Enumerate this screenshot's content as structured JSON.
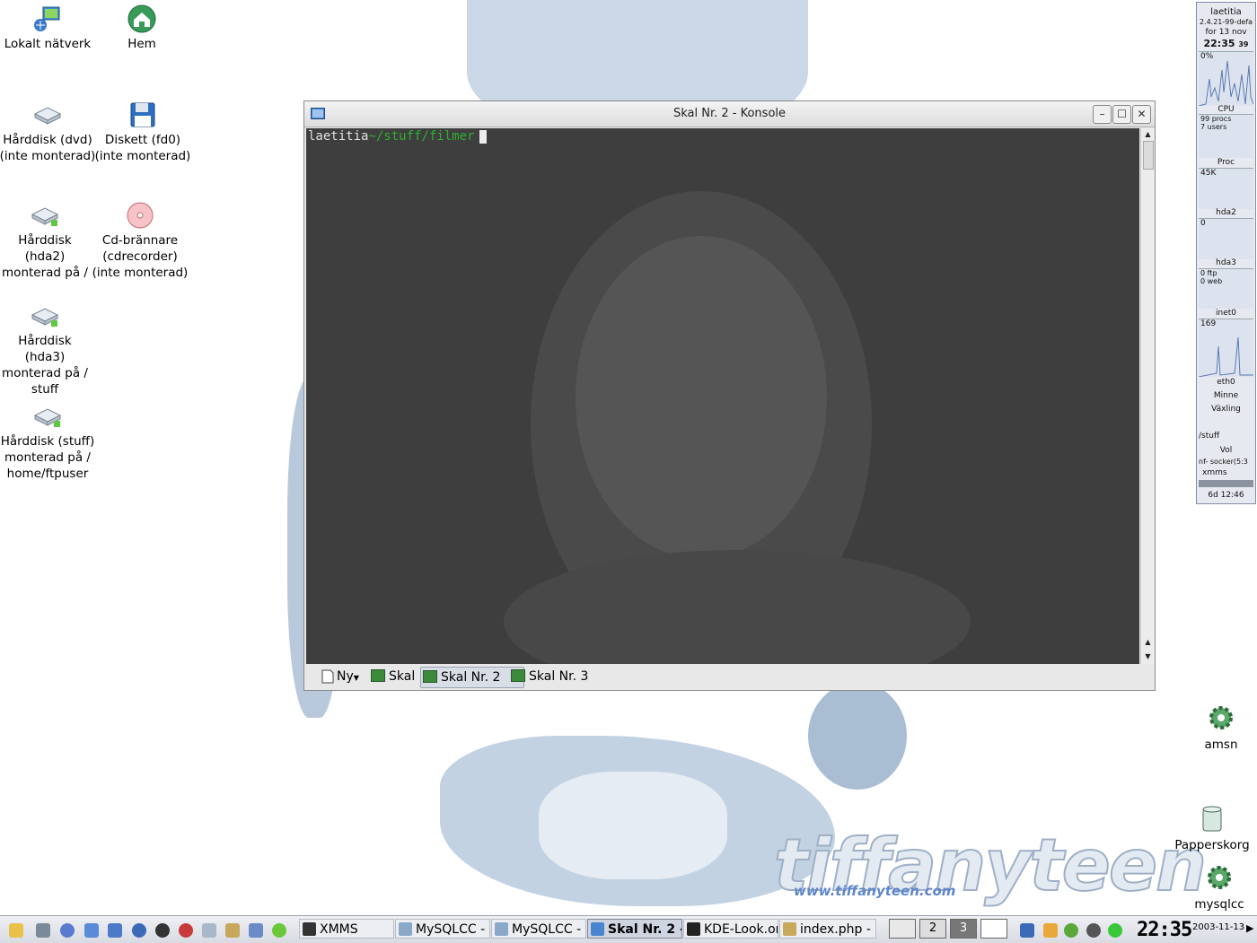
{
  "desktop": {
    "icons_left": [
      {
        "name": "Lokalt nätverk",
        "icon": "network-icon"
      },
      {
        "name": "Hem",
        "icon": "home-icon"
      },
      {
        "name": "Hårddisk (dvd)\n(inte monterad)",
        "icon": "hard-disk-icon"
      },
      {
        "name": "Diskett (fd0)\n(inte monterad)",
        "icon": "floppy-icon"
      },
      {
        "name": "Hårddisk\n(hda2)\nmonterad på /",
        "icon": "hard-disk-icon"
      },
      {
        "name": "Cd-brännare\n(cdrecorder)\n(inte monterad)",
        "icon": "cd-icon"
      },
      {
        "name": "Hårddisk\n(hda3)\nmonterad på /\nstuff",
        "icon": "hard-disk-icon"
      },
      {
        "name": "Hårddisk (stuff)\nmonterad på /\nhome/ftpuser",
        "icon": "hard-disk-icon"
      }
    ],
    "icons_right": [
      {
        "name": "amsn",
        "icon": "gear-icon"
      },
      {
        "name": "Papperskorg",
        "icon": "trash-icon"
      },
      {
        "name": "mysqlcc",
        "icon": "gear-icon"
      }
    ],
    "wallpaper_brand": "tiffanyteen",
    "wallpaper_url": "www.tiffanyteen.com"
  },
  "konsole": {
    "title": "Skal Nr. 2 - Konsole",
    "prompt_host": "laetitia",
    "prompt_path": "~/stuff/filmer",
    "tabs": [
      {
        "label": "Ny"
      },
      {
        "label": "Skal"
      },
      {
        "label": "Skal Nr. 2"
      },
      {
        "label": "Skal Nr. 3"
      }
    ]
  },
  "sysmon": {
    "host": "laetitia",
    "kernel": "2.4.21-99-defa",
    "uptime_line": "for 13 nov",
    "time": "22:35",
    "seconds": "39",
    "cpu_pct": "0%",
    "cpu_label": "CPU",
    "procs": "99 procs",
    "users": "7 users",
    "proc_label": "Proc",
    "hda2_val": "45K",
    "hda2_label": "hda2",
    "hda3_val": "0",
    "hda3_label": "hda3",
    "ftp": "0 ftp",
    "web": "0 web",
    "inet_label": "inet0",
    "inet_val": "169",
    "eth_label": "eth0",
    "minne": "Minne",
    "vaxling": "Växling",
    "stuff": "/stuff",
    "vol": "Vol",
    "socket": "nf- socker(5:3",
    "xmms": "xmms",
    "uptime": "6d 12:46"
  },
  "taskbar": {
    "tasks": [
      {
        "label": "XMMS",
        "active": false
      },
      {
        "label": "MySQLCC -",
        "active": false
      },
      {
        "label": "MySQLCC -",
        "active": false
      },
      {
        "label": "Skal Nr. 2 -",
        "active": true
      },
      {
        "label": "KDE-Look.or",
        "active": false
      },
      {
        "label": "index.php - K",
        "active": false
      }
    ],
    "pager": [
      "2",
      "3"
    ],
    "clock": "22:35",
    "date": "2003-11-13"
  }
}
